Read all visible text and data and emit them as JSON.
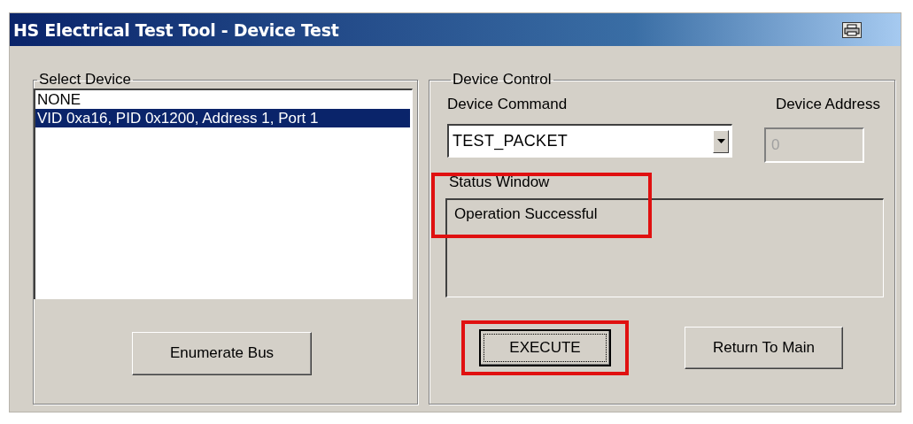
{
  "window": {
    "title": "HS Electrical Test Tool - Device Test"
  },
  "select_device": {
    "label": "Select Device",
    "items": [
      {
        "text": "NONE",
        "selected": false
      },
      {
        "text": "VID 0xa16, PID 0x1200, Address 1, Port 1",
        "selected": true
      }
    ],
    "button": "Enumerate Bus"
  },
  "device_control": {
    "label": "Device Control",
    "command": {
      "label": "Device Command",
      "value": "TEST_PACKET"
    },
    "address": {
      "label": "Device Address",
      "value": "0",
      "disabled": true
    },
    "status": {
      "label": "Status Window",
      "text": "Operation Successful",
      "highlighted": true
    },
    "execute": {
      "label": "EXECUTE",
      "highlighted": true,
      "focused": true
    },
    "return": {
      "label": "Return To Main",
      "highlighted": false
    }
  }
}
